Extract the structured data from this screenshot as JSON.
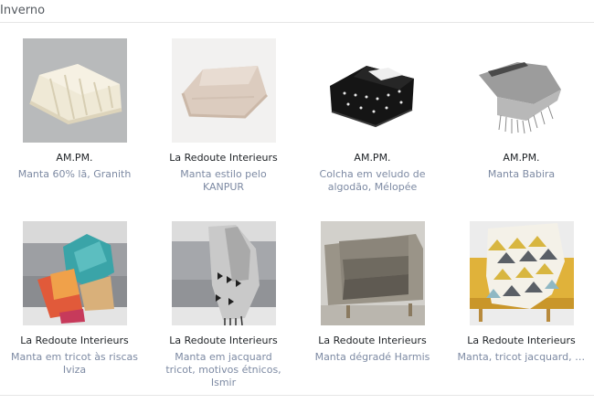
{
  "section": {
    "title": "Inverno"
  },
  "products": [
    {
      "brand": "AM.PM.",
      "name": "Manta 60% lã, Granith"
    },
    {
      "brand": "La Redoute Interieurs",
      "name": "Manta estilo pelo KANPUR"
    },
    {
      "brand": "AM.PM.",
      "name": "Colcha em veludo de algodão, Mélopée"
    },
    {
      "brand": "AM.PM.",
      "name": "Manta Babira"
    },
    {
      "brand": "La Redoute Interieurs",
      "name": "Manta em tricot às riscas Iviza"
    },
    {
      "brand": "La Redoute Interieurs",
      "name": "Manta em jacquard tricot, motivos étnicos, Ismir"
    },
    {
      "brand": "La Redoute Interieurs",
      "name": "Manta dégradé Harmis"
    },
    {
      "brand": "La Redoute Interieurs",
      "name": "Manta, tricot jacquard, Odda"
    }
  ]
}
